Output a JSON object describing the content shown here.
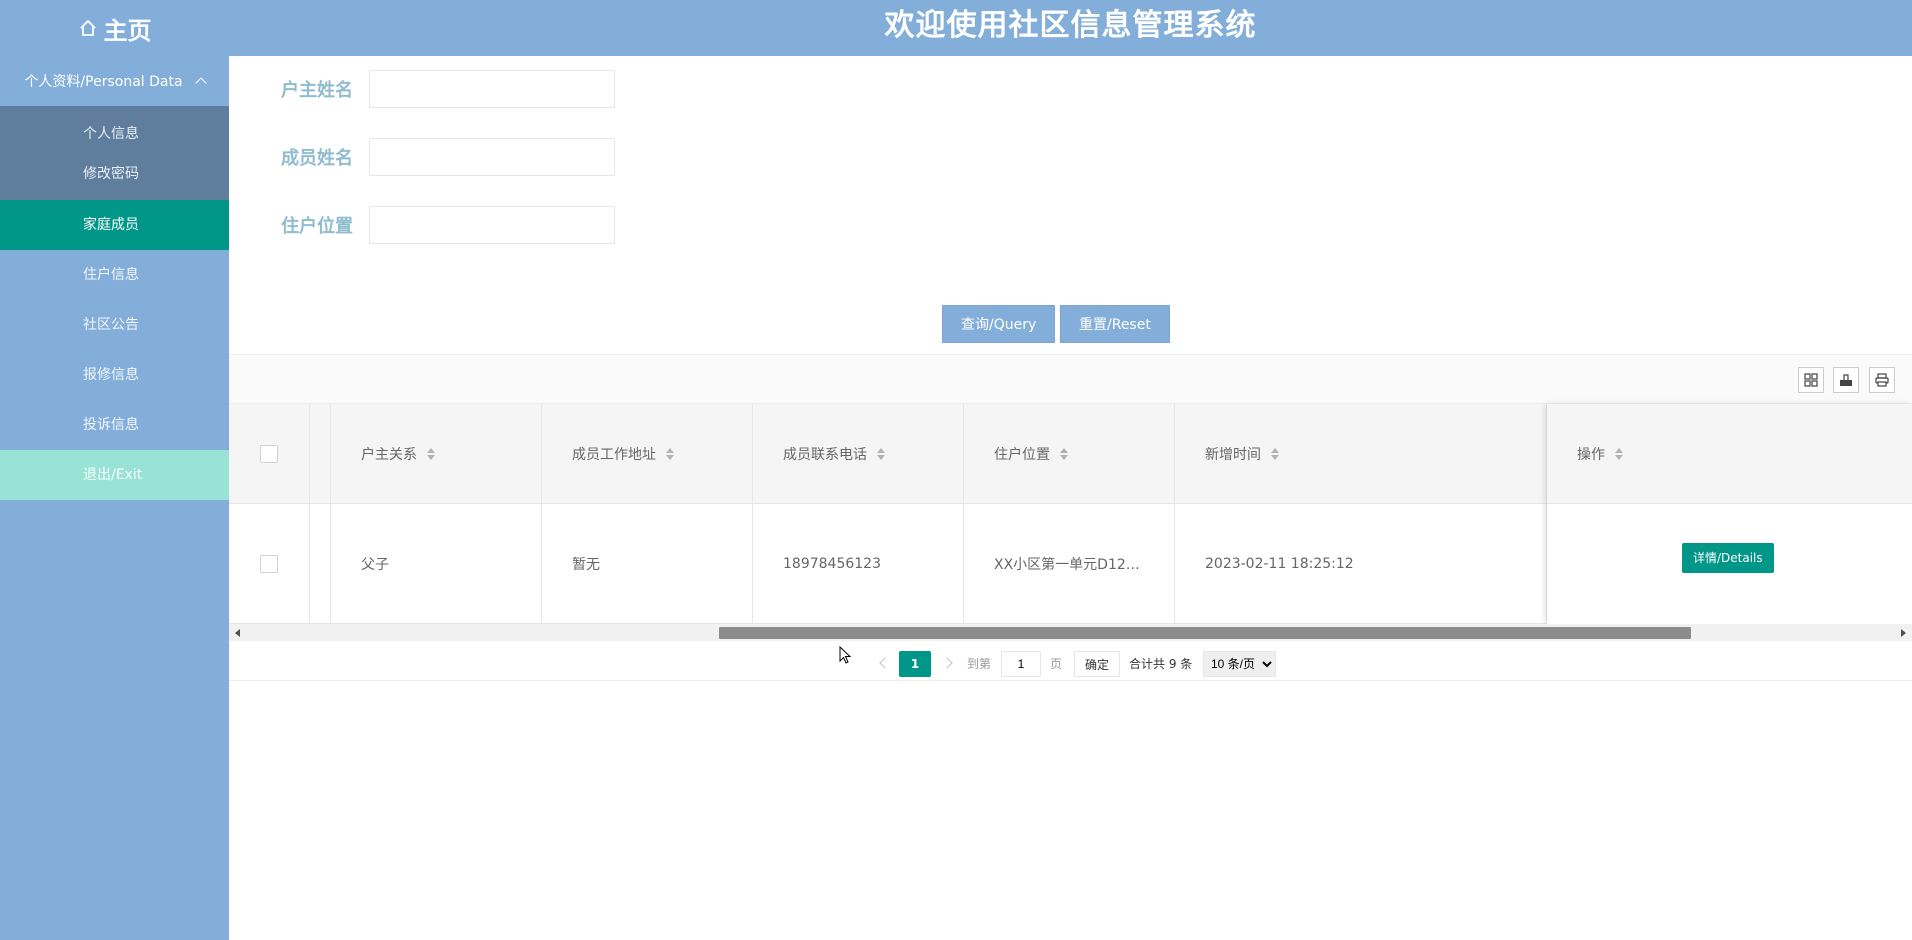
{
  "header": {
    "home_label": "主页",
    "title": "欢迎使用社区信息管理系统"
  },
  "sidebar": {
    "group_label": "个人资料/Personal Data",
    "subitems": [
      "个人信息",
      "修改密码"
    ],
    "items": [
      "家庭成员",
      "住户信息",
      "社区公告",
      "报修信息",
      "投诉信息",
      "退出/Exit"
    ]
  },
  "search": {
    "fields": [
      {
        "label": "户主姓名",
        "value": ""
      },
      {
        "label": "成员姓名",
        "value": ""
      },
      {
        "label": "住户位置",
        "value": ""
      }
    ],
    "query_label": "查询/Query",
    "reset_label": "重置/Reset"
  },
  "table": {
    "columns": [
      "户主关系",
      "成员工作地址",
      "成员联系电话",
      "住户位置",
      "新增时间",
      "操作"
    ],
    "rows": [
      {
        "relation": "父子",
        "work_address": "暂无",
        "phone": "18978456123",
        "location": "XX小区第一单元D12…",
        "created": "2023-02-11 18:25:12",
        "action": "详情/Details"
      }
    ]
  },
  "pager": {
    "current_page": "1",
    "goto_prefix": "到第",
    "goto_value": "1",
    "goto_suffix": "页",
    "confirm_label": "确定",
    "total_text": "合计共 9 条",
    "page_size": "10 条/页"
  },
  "colors": {
    "header_bg": "#82aed9",
    "active_nav": "#009688",
    "exit_nav": "#99e3d6",
    "label_color": "#8fbccf"
  }
}
